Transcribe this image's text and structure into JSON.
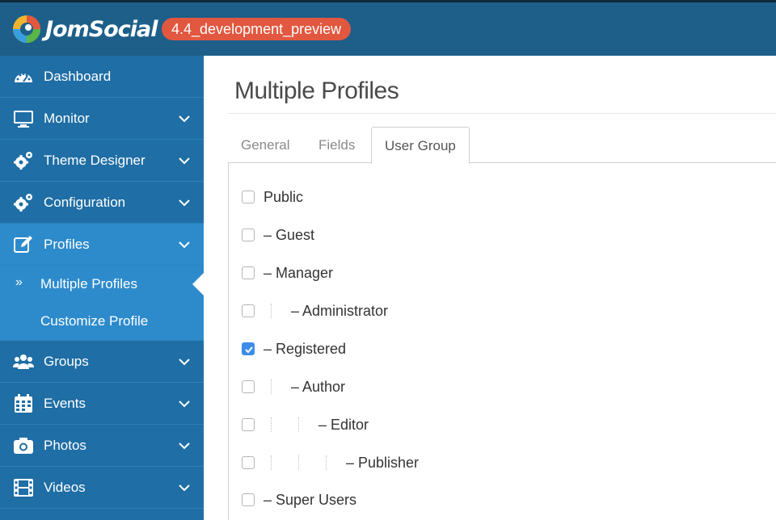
{
  "header": {
    "logo_text": "JomSocial",
    "version_badge": "4.4_development_preview"
  },
  "colors": {
    "header_bg": "#1d5f89",
    "sidebar_bg": "#1f6ea5",
    "sidebar_active": "#2d8bcc",
    "badge": "#e2573f",
    "checkbox_checked": "#3d8de8"
  },
  "sidebar": {
    "items": [
      {
        "label": "Dashboard",
        "icon": "dashboard-icon",
        "expandable": false
      },
      {
        "label": "Monitor",
        "icon": "monitor-icon",
        "expandable": true
      },
      {
        "label": "Theme Designer",
        "icon": "gears-icon",
        "expandable": true
      },
      {
        "label": "Configuration",
        "icon": "gears-icon",
        "expandable": true
      },
      {
        "label": "Profiles",
        "icon": "edit-icon",
        "expandable": true,
        "active": true
      },
      {
        "label": "Groups",
        "icon": "users-icon",
        "expandable": true
      },
      {
        "label": "Events",
        "icon": "calendar-icon",
        "expandable": true
      },
      {
        "label": "Photos",
        "icon": "camera-icon",
        "expandable": true
      },
      {
        "label": "Videos",
        "icon": "film-icon",
        "expandable": true
      }
    ],
    "profiles_submenu": [
      {
        "label": "Multiple Profiles",
        "selected": true,
        "marker": "»"
      },
      {
        "label": "Customize Profile",
        "selected": false
      }
    ]
  },
  "main": {
    "title": "Multiple Profiles",
    "tabs": [
      {
        "label": "General",
        "active": false
      },
      {
        "label": "Fields",
        "active": false
      },
      {
        "label": "User Group",
        "active": true
      }
    ],
    "user_groups": [
      {
        "label": "Public",
        "depth": 0,
        "checked": false
      },
      {
        "label": "– Guest",
        "depth": 0,
        "checked": false
      },
      {
        "label": "– Manager",
        "depth": 0,
        "checked": false
      },
      {
        "label": "– Administrator",
        "depth": 1,
        "checked": false
      },
      {
        "label": "– Registered",
        "depth": 0,
        "checked": true
      },
      {
        "label": "– Author",
        "depth": 1,
        "checked": false
      },
      {
        "label": "– Editor",
        "depth": 2,
        "checked": false
      },
      {
        "label": "– Publisher",
        "depth": 3,
        "checked": false
      },
      {
        "label": "– Super Users",
        "depth": 0,
        "checked": false
      }
    ]
  }
}
